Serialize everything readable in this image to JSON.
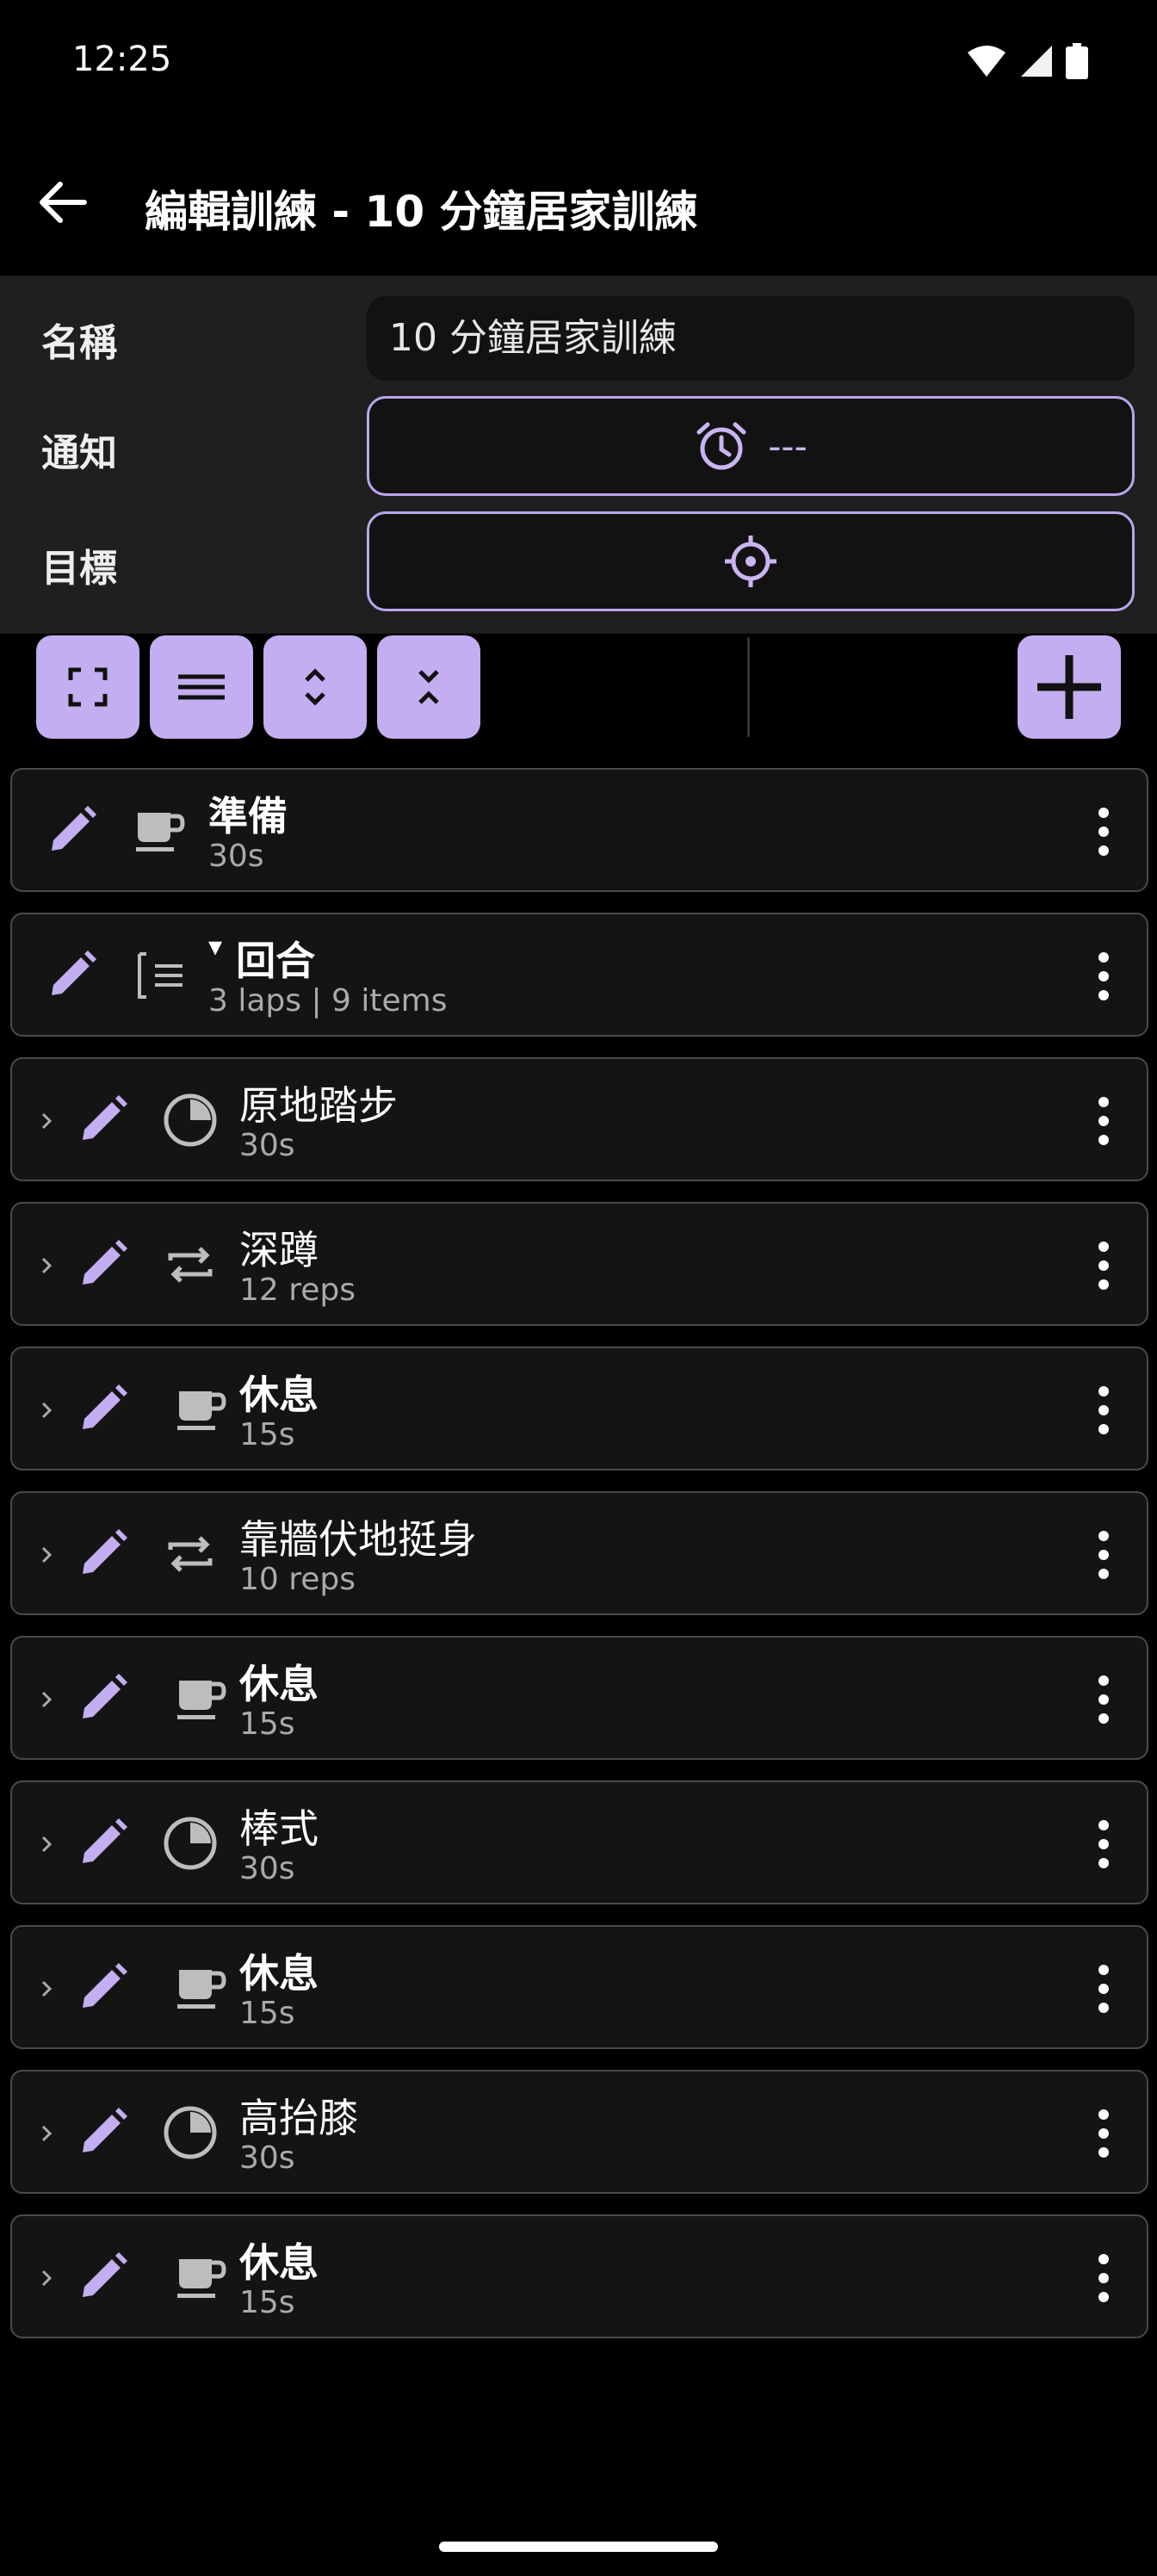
{
  "status_bar": {
    "time": "12:25"
  },
  "app_bar": {
    "title": "編輯訓練 - 10 分鐘居家訓練"
  },
  "form": {
    "name_label": "名稱",
    "name_value": "10 分鐘居家訓練",
    "notify_label": "通知",
    "notify_value": "---",
    "target_label": "目標"
  },
  "list": {
    "items": [
      {
        "name": "準備",
        "sub": "30s",
        "icon": "coffee-cup-icon",
        "bold": true
      },
      {
        "name": "回合",
        "sub": "3 laps | 9 items",
        "icon": "list-group-icon",
        "bold": true,
        "expanded_marker": "▾"
      },
      {
        "name": "原地踏步",
        "sub": "30s",
        "icon": "timer-pie-icon",
        "bold": false
      },
      {
        "name": "深蹲",
        "sub": "12 reps",
        "icon": "repeat-icon",
        "bold": false
      },
      {
        "name": "休息",
        "sub": "15s",
        "icon": "coffee-cup-icon",
        "bold": true
      },
      {
        "name": "靠牆伏地挺身",
        "sub": "10 reps",
        "icon": "repeat-icon",
        "bold": false
      },
      {
        "name": "休息",
        "sub": "15s",
        "icon": "coffee-cup-icon",
        "bold": true
      },
      {
        "name": "棒式",
        "sub": "30s",
        "icon": "timer-pie-icon",
        "bold": false
      },
      {
        "name": "休息",
        "sub": "15s",
        "icon": "coffee-cup-icon",
        "bold": true
      },
      {
        "name": "高抬膝",
        "sub": "30s",
        "icon": "timer-pie-icon",
        "bold": false
      },
      {
        "name": "休息",
        "sub": "15s",
        "icon": "coffee-cup-icon",
        "bold": true
      }
    ]
  },
  "colors": {
    "accent": "#c2aef0",
    "outline": "#b9a5ec",
    "icon_gray": "#bdbdbd"
  }
}
